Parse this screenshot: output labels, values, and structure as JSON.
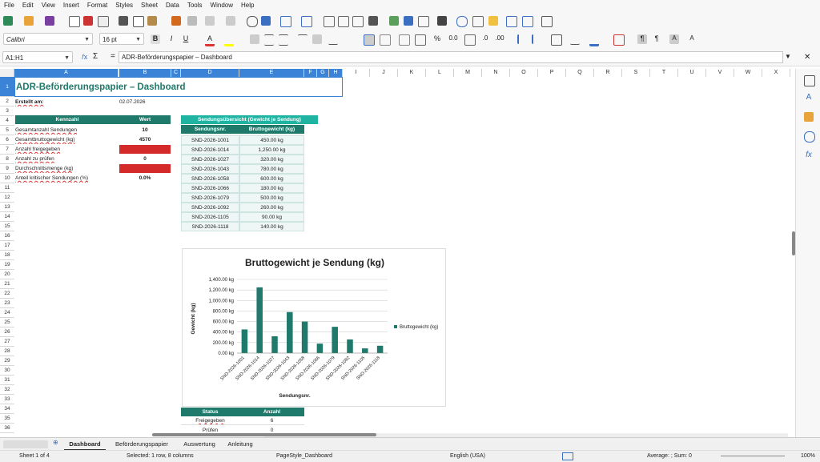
{
  "menu": [
    "File",
    "Edit",
    "View",
    "Insert",
    "Format",
    "Styles",
    "Sheet",
    "Data",
    "Tools",
    "Window",
    "Help"
  ],
  "font": {
    "name": "Calibri",
    "size": "16 pt"
  },
  "formula": {
    "namebox": "A1:H1",
    "fx": "𝑓x",
    "sigma": "Σ",
    "eq": "=",
    "content": "ADR-Beförderungspapier – Dashboard"
  },
  "columns": [
    "A",
    "B",
    "C",
    "D",
    "E",
    "F",
    "G",
    "H",
    "I",
    "J",
    "K",
    "L",
    "M",
    "N",
    "O",
    "P",
    "Q",
    "R",
    "S",
    "T",
    "U",
    "V",
    "W",
    "X"
  ],
  "rows": [
    "1",
    "2",
    "3",
    "4",
    "5",
    "6",
    "7",
    "8",
    "9",
    "10",
    "11",
    "12",
    "13",
    "14",
    "15",
    "16",
    "17",
    "18",
    "19",
    "20",
    "21",
    "22",
    "23",
    "24",
    "25",
    "26",
    "27",
    "28",
    "29",
    "30",
    "31",
    "32",
    "33",
    "34",
    "35",
    "36"
  ],
  "sheet": {
    "title": "ADR-Beförderungspapier – Dashboard",
    "created_label": "Erstellt am:",
    "created_value": "02.07.2026",
    "kpi_header": [
      "Kennzahl",
      "Wert"
    ],
    "kpis": [
      {
        "label": "Gesamtanzahl Sendungen",
        "value": "10",
        "status": "ok"
      },
      {
        "label": "Gesamtbruttogewicht (kg)",
        "value": "4570",
        "status": "ok"
      },
      {
        "label": "Anzahl freigegeben",
        "value": "",
        "status": "error"
      },
      {
        "label": "Anzahl zu prüfen",
        "value": "0",
        "status": "ok"
      },
      {
        "label": "Durchschnittsmenge (kg)",
        "value": "",
        "status": "error"
      },
      {
        "label": "Anteil kritischer Sendungen (%)",
        "value": "0.0%",
        "status": "ok"
      }
    ],
    "overview_title": "Sendungsübersicht (Gewicht je Sendung)",
    "overview_header": [
      "Sendungsnr.",
      "Bruttogewicht (kg)"
    ],
    "overview_rows": [
      [
        "SND-2026-1001",
        "450.00 kg"
      ],
      [
        "SND-2026-1014",
        "1,250.00 kg"
      ],
      [
        "SND-2026-1027",
        "320.00 kg"
      ],
      [
        "SND-2026-1043",
        "780.00 kg"
      ],
      [
        "SND-2026-1058",
        "600.00 kg"
      ],
      [
        "SND-2026-1066",
        "180.00 kg"
      ],
      [
        "SND-2026-1079",
        "500.00 kg"
      ],
      [
        "SND-2026-1092",
        "260.00 kg"
      ],
      [
        "SND-2026-1105",
        "90.00 kg"
      ],
      [
        "SND-2026-1118",
        "140.00 kg"
      ]
    ],
    "status_header": [
      "Status",
      "Anzahl"
    ],
    "status_rows": [
      [
        "Freigegeben",
        "6"
      ],
      [
        "Prüfen",
        "0"
      ]
    ]
  },
  "chart_data": {
    "type": "bar",
    "title": "Bruttogewicht je Sendung (kg)",
    "xlabel": "Sendungsnr.",
    "ylabel": "Gewicht (kg)",
    "categories": [
      "SND-2026-1001",
      "SND-2026-1014",
      "SND-2026-1027",
      "SND-2026-1043",
      "SND-2026-1058",
      "SND-2026-1066",
      "SND-2026-1079",
      "SND-2026-1092",
      "SND-2026-1105",
      "SND-2026-1118"
    ],
    "series": [
      {
        "name": "Bruttogewicht (kg)",
        "values": [
          450,
          1250,
          320,
          780,
          600,
          180,
          500,
          260,
          90,
          140
        ]
      }
    ],
    "yticks": [
      "0.00 kg",
      "200.00 kg",
      "400.00 kg",
      "600.00 kg",
      "800.00 kg",
      "1,000.00 kg",
      "1,200.00 kg",
      "1,400.00 kg"
    ],
    "ylim": [
      0,
      1400
    ],
    "grid": true,
    "legend": "right",
    "color": "#1f7a6b"
  },
  "tabs": [
    "Dashboard",
    "Beförderungspapier",
    "Auswertung",
    "Anleitung"
  ],
  "status": {
    "sheet": "Sheet 1 of 4",
    "selected": "Selected: 1 row, 8 columns",
    "pagestyle": "PageStyle_Dashboard",
    "lang": "English (USA)",
    "avg": "Average: ; Sum: 0",
    "zoom": "100%"
  },
  "colors": {
    "accent": "#1f7a6b",
    "error": "#d42a2a",
    "select": "#3a83d6"
  }
}
